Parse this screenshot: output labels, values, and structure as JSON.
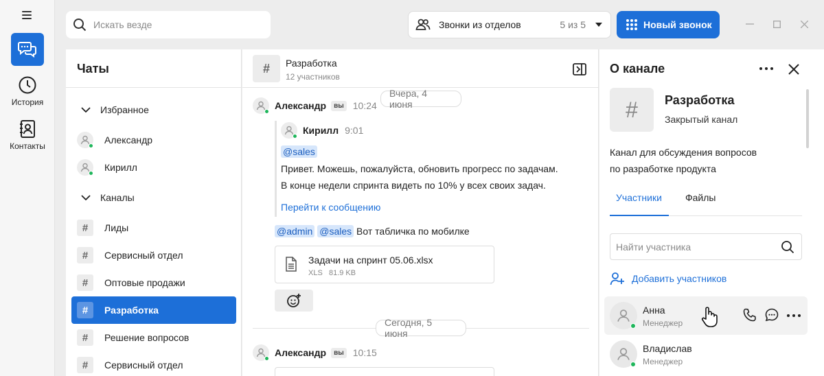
{
  "rail": {
    "history_label": "История",
    "contacts_label": "Контакты"
  },
  "top": {
    "search_placeholder": "Искать везде",
    "calls_filter_label": "Звонки из отделов",
    "calls_filter_count": "5 из 5",
    "new_call_label": "Новый звонок"
  },
  "chats": {
    "title": "Чаты",
    "favorites_header": "Избранное",
    "favorites": [
      {
        "name": "Александр"
      },
      {
        "name": "Кирилл"
      }
    ],
    "channels_header": "Каналы",
    "channels": [
      {
        "name": "Лиды"
      },
      {
        "name": "Сервисный отдел"
      },
      {
        "name": "Оптовые продажи"
      },
      {
        "name": "Разработка",
        "active": true
      },
      {
        "name": "Решение вопросов"
      },
      {
        "name": "Сервисный отдел"
      }
    ]
  },
  "conversation": {
    "channel_name": "Разработка",
    "participants": "12 участников",
    "date1": "Вчера, 4 июня",
    "msg1": {
      "author": "Александр",
      "you_badge": "вы",
      "time": "10:24",
      "quote_author": "Кирилл",
      "quote_time": "9:01",
      "quote_mention": "@sales",
      "quote_line1": "Привет. Можешь, пожалуйста, обновить прогресс по задачам.",
      "quote_line2": "В конце недели спринта видеть по 10% у всех своих задач.",
      "goto_link": "Перейти к сообщению",
      "mention_admin": "@admin",
      "mention_sales": "@sales",
      "text": "Вот табличка по мобилке",
      "file_name": "Задачи на спринт 05.06.xlsx",
      "file_type": "XLS",
      "file_size": "81.9 KB"
    },
    "date2": "Сегодня, 5 июня",
    "msg2": {
      "author": "Александр",
      "you_badge": "вы",
      "time": "10:15"
    }
  },
  "info": {
    "title": "О канале",
    "channel_name": "Разработка",
    "channel_type": "Закрытый канал",
    "description_line1": "Канал для обсуждения вопросов",
    "description_line2": "по разработке продукта",
    "tab_members": "Участники",
    "tab_files": "Файлы",
    "member_search_placeholder": "Найти участника",
    "add_members": "Добавить участников",
    "members": [
      {
        "name": "Анна",
        "role": "Менеджер"
      },
      {
        "name": "Владислав",
        "role": "Менеджер"
      }
    ]
  },
  "colors": {
    "accent": "#1d6fd8",
    "online": "#1fb65b",
    "mention_bg": "#d6e6fb"
  }
}
